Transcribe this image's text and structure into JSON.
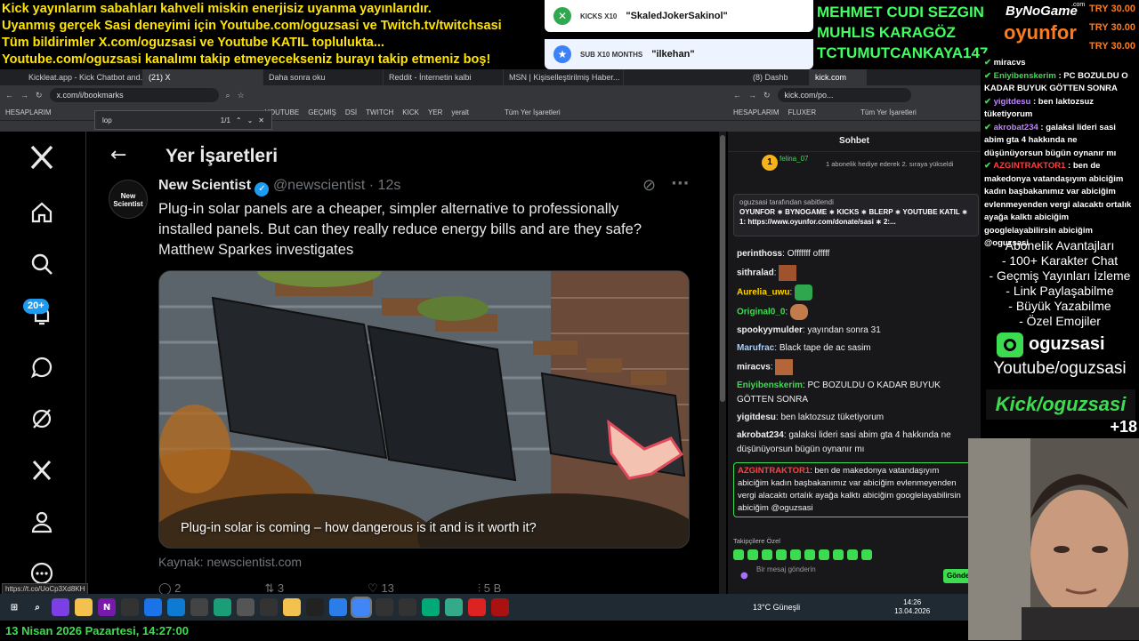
{
  "ticker": [
    "Kick yayınlarım sabahları kahveli miskin enerjisiz uyanma yayınlarıdır.",
    "Uyanmış gerçek Sasi deneyimi için Youtube.com/oguzsasi ve Twitch.tv/twitchsasi",
    "Tüm bildirimler X.com/oguzsasi ve Youtube KATIL toplulukta...",
    "Youtube.com/oguzsasi kanalımı takip etmeyecekseniz burayı takip etmeniz boş!"
  ],
  "alerts": [
    {
      "tag": "KICKS X10",
      "name": "\"SkaledJokerSakinol\"",
      "color": "#2fa84f",
      "icon": "x-icon"
    },
    {
      "tag": "SUB X10 MONTHS",
      "name": "\"ilkehan\"",
      "color": "#3b82f6",
      "icon": "star-icon"
    }
  ],
  "names": [
    "MEHMET CUDI SEZGIN",
    "MUHLIS KARAGÖZ",
    "TCTUMUTCANKAYA147"
  ],
  "brand": {
    "top": "ByNoGame",
    "small": ".com",
    "bottom": "oyunfor"
  },
  "try": [
    "TRY 30.00",
    "TRY 30.00",
    "TRY 30.00"
  ],
  "left_browser": {
    "tabs": [
      "Kickleat.app - Kick Chatbot and...",
      "(21) X",
      "Daha sonra oku",
      "Reddit - İnternetin kalbi",
      "MSN | Kişiselleştirilmiş Haber..."
    ],
    "url": "x.com/i/bookmarks",
    "bookmarks": [
      "HESAPLARIM",
      "YOUTUBE",
      "GEÇMİŞ",
      "DSİ",
      "TWITCH",
      "KICK",
      "YER",
      "yeralt",
      "Tüm Yer İşaretleri"
    ],
    "find": {
      "query": "lop",
      "count": "1/1"
    }
  },
  "right_browser": {
    "tabs": [
      "(8) Dashb",
      "kick.com"
    ],
    "url": "kick.com/po...",
    "bookmarks": [
      "HESAPLARIM",
      "FLUXER",
      "Tüm Yer İşaretleri"
    ]
  },
  "x_page": {
    "badge": "20+",
    "title": "Yer İşaretleri",
    "author": "New Scientist",
    "handle": "@newscientist",
    "time": "· 12s",
    "avatar_text": "New Scientist",
    "text": "Plug-in solar panels are a cheaper, simpler alternative to professionally installed panels. But can they really reduce energy bills and are they safe? Matthew Sparkes investigates",
    "caption": "Plug-in solar is coming – how dangerous is it and is it worth it?",
    "source": "Kaynak: newscientist.com",
    "stats": [
      "2",
      "3",
      "13",
      "5 B"
    ],
    "status_url": "https://t.co/UoCp3Xd8KH"
  },
  "chat": {
    "header": "Sohbet",
    "top_user": "felina_07",
    "top_text": "1 abonelik hediye ederek 2. sıraya yükseldi",
    "pinned_by": "oguzsasi tarafından sabitlendi",
    "pinned_text": "OYUNFOR ∗ BYNOGAME ∗ KICKS ∗ BLERP ∗ YOUTUBE KATIL ∗ 1: https://www.oyunfor.com/donate/sasi ∗ 2:...",
    "messages": [
      {
        "user": "perinthoss",
        "color": "#ffffff",
        "text": "Offfffff offfff"
      },
      {
        "user": "sithralad",
        "color": "#ffffff",
        "text": ""
      },
      {
        "user": "Aurelia_uwu",
        "color": "#ffd400",
        "text": ""
      },
      {
        "user": "Original0_0",
        "color": "#3ddc50",
        "text": ""
      },
      {
        "user": "spookyymulder",
        "color": "#ffffff",
        "text": "yayından sonra 31"
      },
      {
        "user": "Marufrac",
        "color": "#9fd0ff",
        "text": "Black tape de ac sasim"
      },
      {
        "user": "miracvs",
        "color": "#ffffff",
        "text": ""
      },
      {
        "user": "Eniyibenskerim",
        "color": "#3ddc50",
        "text": "PC BOZULDU O KADAR BUYUK GÖTTEN SONRA"
      },
      {
        "user": "yigitdesu",
        "color": "#ffffff",
        "text": "ben laktozsuz tüketiyorum"
      },
      {
        "user": "akrobat234",
        "color": "#ffffff",
        "text": "galaksi lideri sasi abim gta 4 hakkında ne düşünüyorsun bügün oynanır mı"
      }
    ],
    "highlight": {
      "user": "AZGINTRAKTOR1",
      "text": "ben de makedonya vatandaşıyım abiciğim kadın başbakanımız var abiciğim evlenmeyenden vergi alacaktı ortalık ayağa kalktı abiciğim googlelayabilirsin abiciğim @oguzsasi"
    },
    "emote_label": "Takipçilere Özel",
    "input_placeholder": "Bir mesaj gönderin",
    "send": "Gönder"
  },
  "sidebar": {
    "messages": [
      {
        "user": "miracvs",
        "text": ""
      },
      {
        "user": "Eniyibenskerim",
        "text": "PC BOZULDU O KADAR BUYUK GÖTTEN SONRA"
      },
      {
        "user": "yigitdesu",
        "text": "ben laktozsuz tüketiyorum"
      },
      {
        "user": "akrobat234",
        "text": "galaksi lideri sasi abim gta 4 hakkında ne düşünüyorsun bügün oynanır mı"
      },
      {
        "user": "AZGINTRAKTOR1",
        "text": "ben de makedonya vatandaşıyım abiciğim kadın başbakanımız var abiciğim evlenmeyenden vergi alacaktı ortalık ayağa kalktı abiciğim googlelayabilirsin abiciğim @oguzsasi"
      }
    ],
    "perks_title": "Abonelik Avantajları",
    "perks": [
      "- 100+ Karakter Chat",
      "- Geçmiş Yayınları İzleme",
      "- Link Paylaşabilme",
      "- Büyük Yazabilme",
      "- Özel Emojiler"
    ],
    "channel": "oguzsasi",
    "youtube": "Youtube/oguzsasi",
    "kick": "Kick/oguzsasi",
    "viewers": "+18"
  },
  "taskbar": {
    "weather": "13°C Güneşli",
    "time": "14:26",
    "date": "13.04.2026"
  },
  "bottom_clock": "13 Nisan 2026 Pazartesi, 14:27:00"
}
